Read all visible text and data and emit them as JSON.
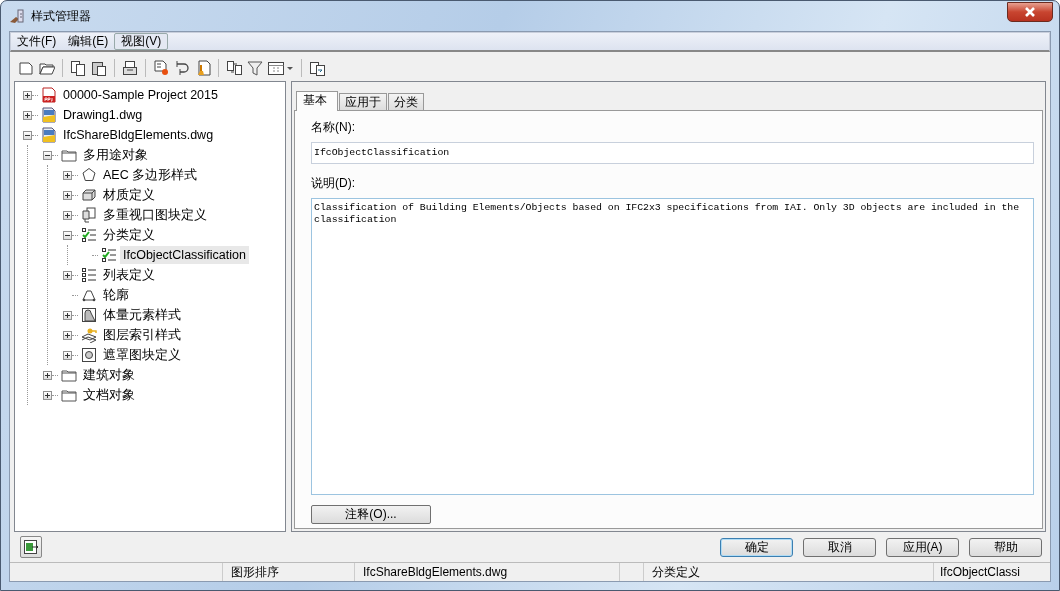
{
  "window": {
    "title": "样式管理器"
  },
  "menu": [
    {
      "label": "文件(F)",
      "selected": false
    },
    {
      "label": "编辑(E)",
      "selected": false
    },
    {
      "label": "视图(V)",
      "selected": true
    }
  ],
  "tree": [
    {
      "label": "00000-Sample Project 2015",
      "kind": "project",
      "expanded": false,
      "selected": false
    },
    {
      "label": "Drawing1.dwg",
      "kind": "drawing",
      "expanded": false,
      "selected": false
    },
    {
      "label": "IfcShareBldgElements.dwg",
      "kind": "drawing",
      "expanded": true,
      "selected": false,
      "children": [
        {
          "label": "多用途对象",
          "kind": "folder",
          "expanded": true,
          "selected": false,
          "children": [
            {
              "label": "AEC 多边形样式",
              "kind": "polygon",
              "expanded": false,
              "selected": false
            },
            {
              "label": "材质定义",
              "kind": "material",
              "expanded": false,
              "selected": false
            },
            {
              "label": "多重视口图块定义",
              "kind": "multiview",
              "expanded": false,
              "selected": false
            },
            {
              "label": "分类定义",
              "kind": "classification",
              "expanded": true,
              "selected": false,
              "children": [
                {
                  "label": "IfcObjectClassification",
                  "kind": "classification",
                  "selected": true
                }
              ]
            },
            {
              "label": "列表定义",
              "kind": "list",
              "expanded": false,
              "selected": false
            },
            {
              "label": "轮廓",
              "kind": "profile",
              "selected": false
            },
            {
              "label": "体量元素样式",
              "kind": "mass",
              "expanded": false,
              "selected": false
            },
            {
              "label": "图层索引样式",
              "kind": "layerkey",
              "expanded": false,
              "selected": false
            },
            {
              "label": "遮罩图块定义",
              "kind": "mask",
              "expanded": false,
              "selected": false
            }
          ]
        },
        {
          "label": "建筑对象",
          "kind": "folder",
          "expanded": false,
          "selected": false
        },
        {
          "label": "文档对象",
          "kind": "folder",
          "expanded": false,
          "selected": false
        }
      ]
    }
  ],
  "tabs": [
    {
      "label": "基本",
      "selected": true
    },
    {
      "label": "应用于",
      "selected": false
    },
    {
      "label": "分类",
      "selected": false
    }
  ],
  "name_label": "名称(N):",
  "name_value": "IfcObjectClassification",
  "description_label": "说明(D):",
  "description_value": "Classification of Building Elements/Objects based on IFC2x3 specifications from IAI. Only 3D objects are included in the classification",
  "notes_button": "注释(O)...",
  "buttons": [
    {
      "label": "确定",
      "default": true
    },
    {
      "label": "取消",
      "default": false
    },
    {
      "label": "应用(A)",
      "default": false
    },
    {
      "label": "帮助",
      "default": false
    }
  ],
  "status_bar": [
    "图形排序",
    "IfcShareBldgElements.dwg",
    "分类定义",
    "IfcObjectClassi"
  ]
}
